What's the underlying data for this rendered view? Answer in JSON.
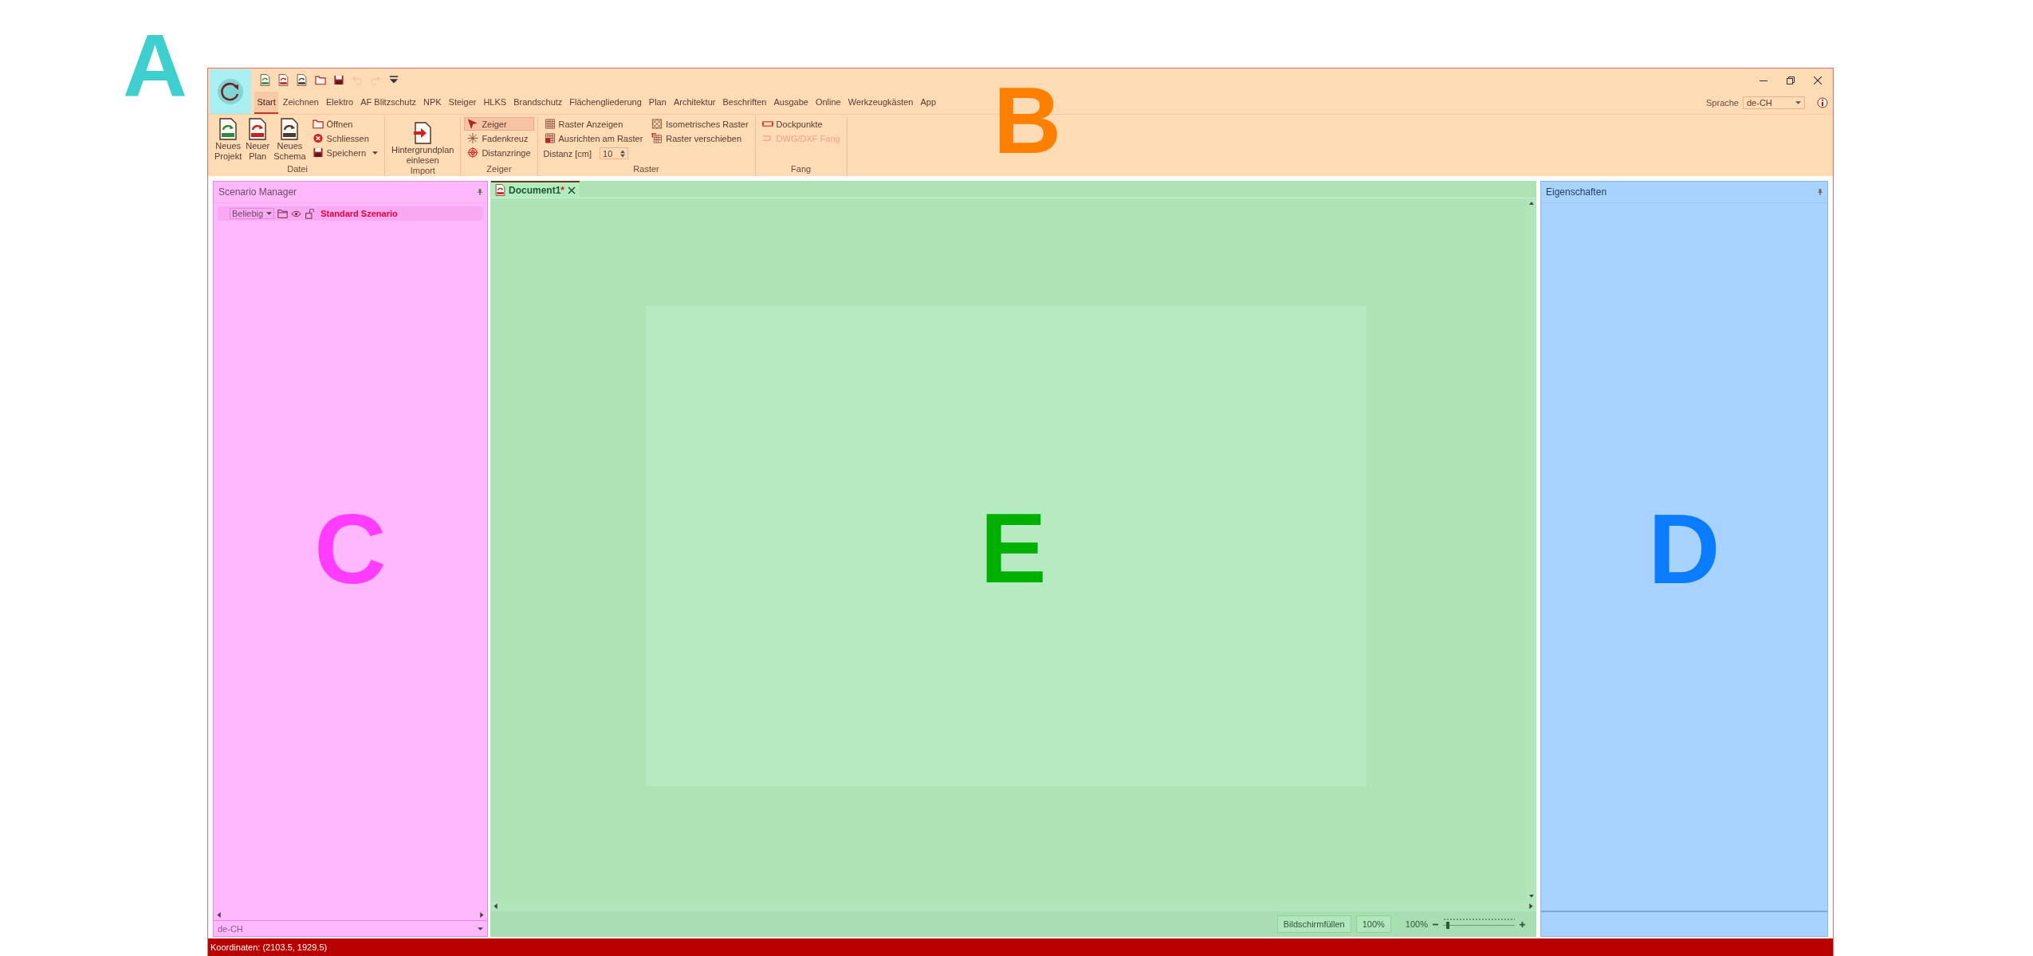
{
  "region_marks": [
    {
      "label": "A",
      "color": "#3fcfcf"
    },
    {
      "label": "B",
      "color": "#ff7f00"
    },
    {
      "label": "C",
      "color": "#ff3cff"
    },
    {
      "label": "E",
      "color": "#00b000"
    },
    {
      "label": "D",
      "color": "#0a7cff"
    }
  ],
  "quick_access": [
    {
      "disabled": false
    },
    {
      "disabled": false
    },
    {
      "disabled": false
    },
    {
      "disabled": false
    },
    {
      "disabled": false
    },
    {
      "disabled": true
    },
    {
      "disabled": true
    },
    {
      "disabled": false
    }
  ],
  "tabs": [
    {
      "label": "Start",
      "selected": true
    },
    {
      "label": "Zeichnen",
      "selected": false
    },
    {
      "label": "Elektro",
      "selected": false
    },
    {
      "label": "AF Blitzschutz",
      "selected": false
    },
    {
      "label": "NPK",
      "selected": false
    },
    {
      "label": "Steiger",
      "selected": false
    },
    {
      "label": "HLKS",
      "selected": false
    },
    {
      "label": "Brandschutz",
      "selected": false
    },
    {
      "label": "Flächengliederung",
      "selected": false
    },
    {
      "label": "Plan",
      "selected": false
    },
    {
      "label": "Architektur",
      "selected": false
    },
    {
      "label": "Beschriften",
      "selected": false
    },
    {
      "label": "Ausgabe",
      "selected": false
    },
    {
      "label": "Online",
      "selected": false
    },
    {
      "label": "Werkzeugkästen",
      "selected": false
    },
    {
      "label": "App",
      "selected": false
    }
  ],
  "language": {
    "label": "Sprache",
    "value": "de-CH"
  },
  "ribbon": {
    "groups": [
      {
        "label": "Datei",
        "items": [
          {
            "label": "Neues Projekt"
          },
          {
            "label": "Neuer Plan"
          },
          {
            "label": "Neues Schema"
          },
          {
            "label": "Öffnen"
          },
          {
            "label": "Schliessen"
          },
          {
            "label": "Speichern"
          }
        ]
      },
      {
        "label": "Import",
        "items": [
          {
            "label": "Hintergrundplan einlesen"
          }
        ]
      },
      {
        "label": "Zeiger",
        "items": [
          {
            "label": "Zeiger",
            "selected": true
          },
          {
            "label": "Fadenkreuz",
            "selected": false
          },
          {
            "label": "Distanzringe",
            "selected": false
          }
        ]
      },
      {
        "label": "Raster",
        "items": [
          {
            "label": "Raster Anzeigen"
          },
          {
            "label": "Ausrichten am Raster"
          },
          {
            "label": "Isometrisches Raster"
          },
          {
            "label": "Raster verschieben"
          }
        ],
        "distance": {
          "label": "Distanz [cm]",
          "value": "10"
        }
      },
      {
        "label": "Fang",
        "items": [
          {
            "label": "Dockpunkte",
            "disabled": false
          },
          {
            "label": "DWG/DXF Fang",
            "disabled": true
          }
        ]
      }
    ]
  },
  "scenario_manager": {
    "title": "Scenario Manager",
    "filter": "Beliebig",
    "scenario": "Standard Szenario",
    "language": "de-CH"
  },
  "document": {
    "tab": {
      "title": "Document1",
      "modified_mark": "*",
      "selected": true
    }
  },
  "zoom": {
    "fit_button": "Bildschirmfüllen",
    "reset_button": "100%",
    "reading": "100%",
    "level": 0.04
  },
  "properties": {
    "title": "Eigenschaften"
  },
  "status_bar": {
    "coordinates": "Koordinaten: (2103.5, 1929.5)"
  }
}
